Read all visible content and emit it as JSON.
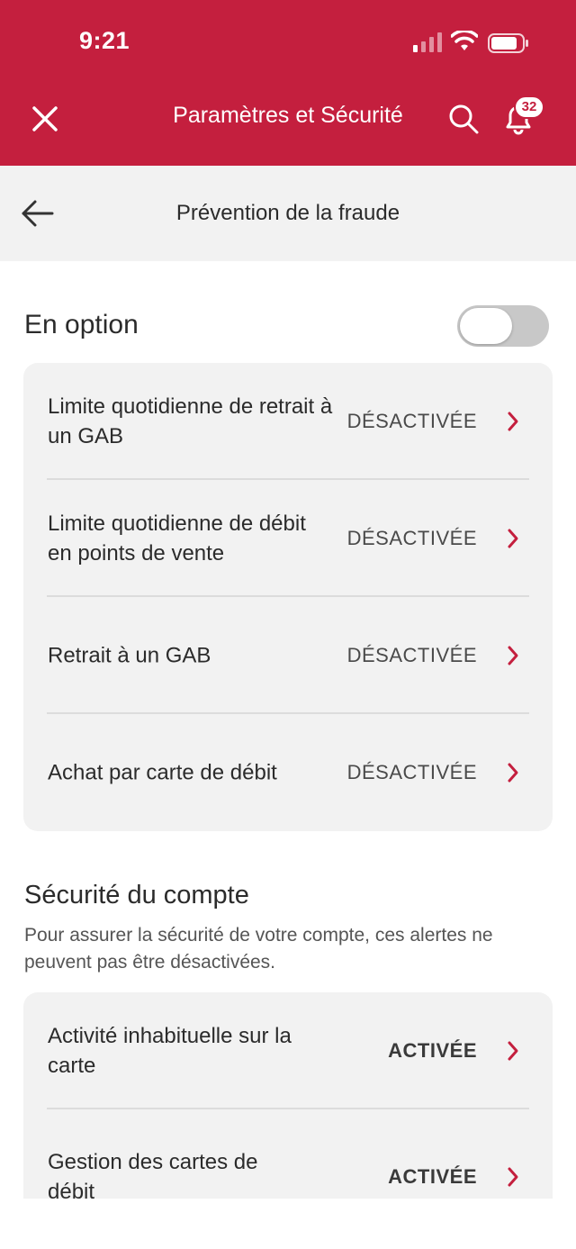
{
  "status_bar": {
    "time": "9:21"
  },
  "header": {
    "title": "Paramètres et Sécurité",
    "notification_count": "32",
    "icons": [
      "close-icon",
      "search-icon",
      "bell-icon"
    ],
    "bg_color": "#c41f3e"
  },
  "subheader": {
    "title": "Prévention de la fraude"
  },
  "optional": {
    "title": "En option",
    "toggle_on": false,
    "rows": [
      {
        "label": "Limite quotidienne de retrait à un GAB",
        "status": "DÉSACTIVÉE"
      },
      {
        "label": "Limite quotidienne de débit en points de vente",
        "status": "DÉSACTIVÉE"
      },
      {
        "label": "Retrait à un GAB",
        "status": "DÉSACTIVÉE"
      },
      {
        "label": "Achat par carte de débit",
        "status": "DÉSACTIVÉE"
      }
    ]
  },
  "account_security": {
    "title": "Sécurité du compte",
    "description": "Pour assurer la sécurité de votre compte, ces alertes ne peuvent pas être désactivées.",
    "rows": [
      {
        "label": "Activité inhabituelle sur la carte",
        "status": "ACTIVÉE"
      },
      {
        "label": "Gestion des cartes de débit",
        "status": "ACTIVÉE"
      }
    ]
  },
  "accent_color": "#c41f3e"
}
